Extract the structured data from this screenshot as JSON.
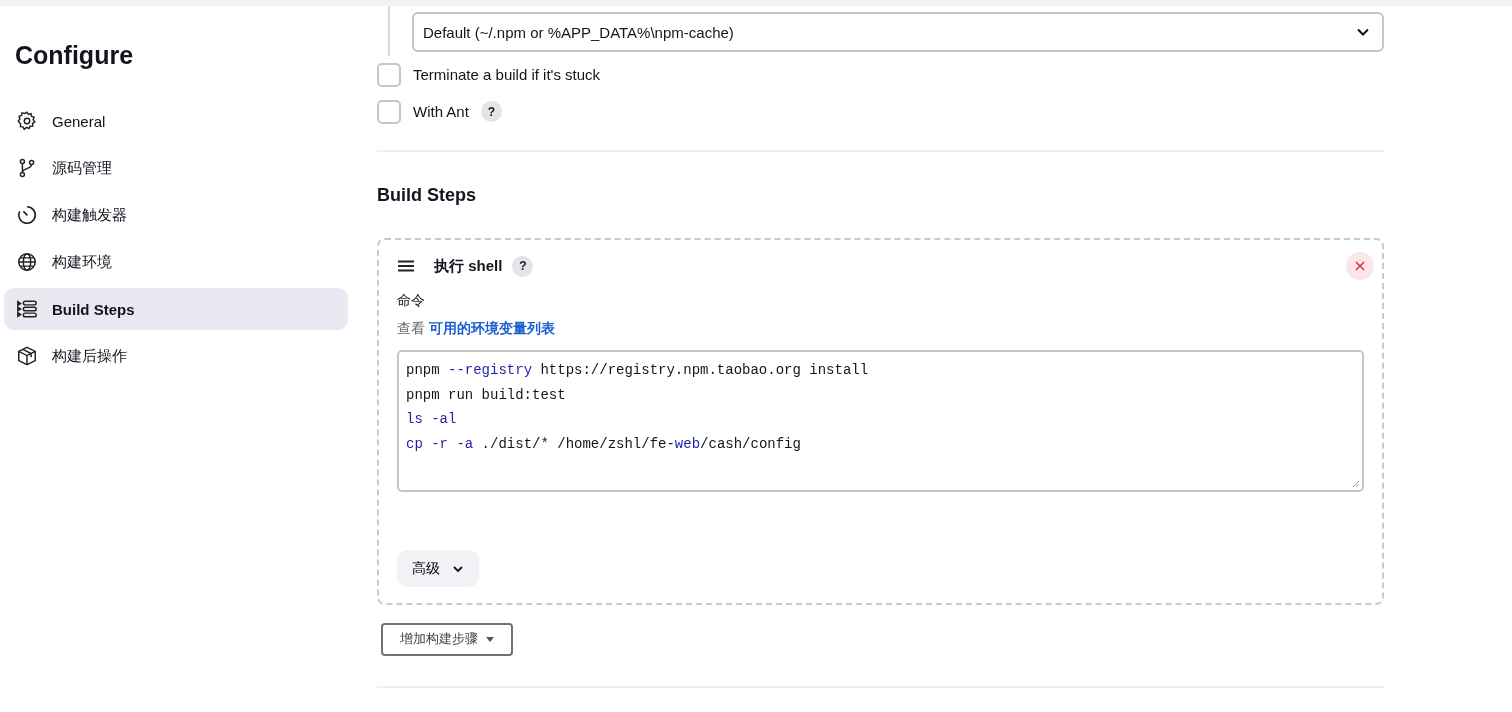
{
  "sidebar": {
    "title": "Configure",
    "items": [
      {
        "label": "General",
        "selected": false
      },
      {
        "label": "源码管理",
        "selected": false
      },
      {
        "label": "构建触发器",
        "selected": false
      },
      {
        "label": "构建环境",
        "selected": false
      },
      {
        "label": "Build Steps",
        "selected": true
      },
      {
        "label": "构建后操作",
        "selected": false
      }
    ]
  },
  "cache_select": {
    "value": "Default (~/.npm or %APP_DATA%\\npm-cache)"
  },
  "options": [
    {
      "label": "Terminate a build if it's stuck",
      "checked": false
    },
    {
      "label": "With Ant",
      "checked": false,
      "help": "?"
    }
  ],
  "build_steps": {
    "heading": "Build Steps",
    "step": {
      "title": "执行 shell",
      "help": "?",
      "field_label": "命令",
      "hint": "查看",
      "hint_link": "可用的环境变量列表",
      "command_lines": [
        [
          {
            "text": "pnpm ",
            "kind": "plain"
          },
          {
            "text": "--registry",
            "kind": "keyword"
          },
          {
            "text": " https://registry.npm.taobao.org install",
            "kind": "plain"
          }
        ],
        [
          {
            "text": "pnpm run build:test",
            "kind": "plain"
          }
        ],
        [
          {
            "text": "ls -al",
            "kind": "keyword"
          }
        ],
        [
          {
            "text": "cp -r -a",
            "kind": "keyword"
          },
          {
            "text": " ./dist/* /home/zshl/fe-",
            "kind": "plain"
          },
          {
            "text": "web",
            "kind": "keyword"
          },
          {
            "text": "/cash/config",
            "kind": "plain"
          }
        ]
      ],
      "advanced": "高级"
    },
    "add_button": "增加构建步骤"
  }
}
